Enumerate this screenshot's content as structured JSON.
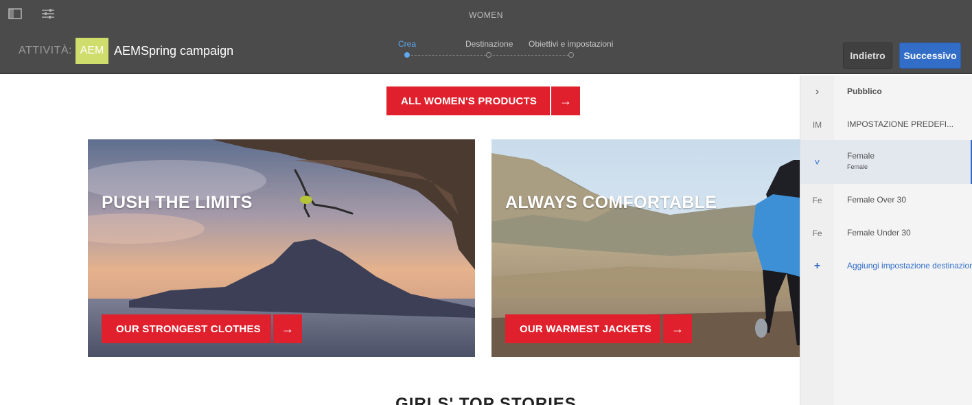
{
  "header": {
    "page_name": "WOMEN",
    "activity_label": "ATTIVITÀ:",
    "badge": "AEM",
    "campaign_name": "AEMSpring campaign",
    "steps": [
      {
        "label": "Crea",
        "active": true
      },
      {
        "label": "Destinazione",
        "active": false
      },
      {
        "label": "Obiettivi e impostazioni",
        "active": false
      }
    ],
    "back_label": "Indietro",
    "next_label": "Successivo"
  },
  "content": {
    "all_products_label": "ALL WOMEN'S PRODUCTS",
    "arrow": "→",
    "hero_left": {
      "title": "PUSH THE LIMITS",
      "cta": "OUR STRONGEST CLOTHES"
    },
    "hero_right": {
      "title": "ALWAYS COMFORTABLE",
      "cta": "OUR WARMEST JACKETS"
    },
    "section_title": "GIRLS' TOP STORIES"
  },
  "panel": {
    "rows": [
      {
        "icon": "›",
        "label": "Pubblico"
      },
      {
        "icon": "IM",
        "label": "IMPOSTAZIONE PREDEFI..."
      },
      {
        "icon": "˅",
        "label": "Female",
        "sub": "Female"
      },
      {
        "icon": "Fe",
        "label": "Female Over 30"
      },
      {
        "icon": "Fe",
        "label": "Female Under 30"
      },
      {
        "icon": "+",
        "label": "Aggiungi impostazione destinazione"
      }
    ]
  },
  "colors": {
    "header_bg": "#4b4b4b",
    "accent_red": "#e0212d",
    "primary_blue": "#326ec8",
    "badge_green": "#cedd6b"
  }
}
